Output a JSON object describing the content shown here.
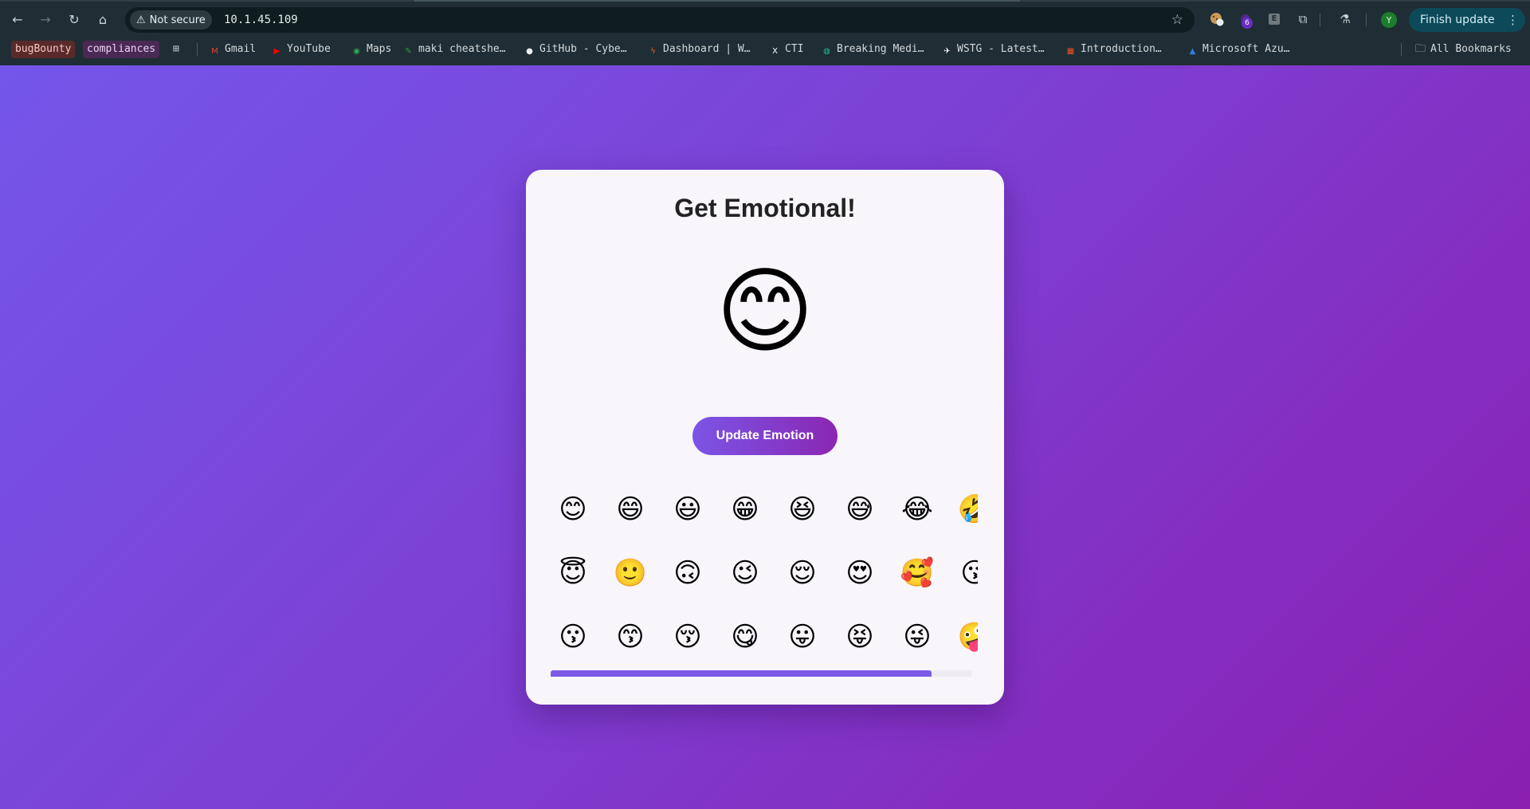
{
  "browser": {
    "security_label": "Not secure",
    "url": "10.1.45.109",
    "extension_badge": "6",
    "avatar_letter": "Y",
    "finish_update_label": "Finish update",
    "icons": {
      "back": "←",
      "forward": "→",
      "reload": "↻",
      "home": "⌂",
      "warning": "⚠",
      "star": "☆",
      "extensions": "⧉",
      "labs": "⚗",
      "menu": "⋮"
    }
  },
  "bookmarks": {
    "items": [
      {
        "label": "bugBounty",
        "name": "bookmark-bugbounty",
        "chip_bg": "#5a2a2a",
        "color": "#f3c9c2"
      },
      {
        "label": "compliances",
        "name": "bookmark-compliances",
        "chip_bg": "#4a2a55",
        "color": "#ecd2f4"
      },
      {
        "label": "⊞",
        "name": "bookmark-apps",
        "color": "#c8d2d4"
      },
      {
        "label": "Gmail",
        "name": "bookmark-gmail",
        "icon": "M",
        "icon_color": "#ea4335"
      },
      {
        "label": "YouTube",
        "name": "bookmark-youtube",
        "icon": "▶",
        "icon_color": "#ff0000"
      },
      {
        "label": "Maps",
        "name": "bookmark-maps",
        "icon": "◉",
        "icon_color": "#34a853"
      },
      {
        "label": "maki cheatshe…",
        "name": "bookmark-maki-cheatsheet",
        "icon": "✎",
        "icon_color": "#2ea043"
      },
      {
        "label": "GitHub - Cybe…",
        "name": "bookmark-github",
        "icon": "●",
        "icon_color": "#e6eeee"
      },
      {
        "label": "Dashboard | W…",
        "name": "bookmark-dashboard",
        "icon": "ϟ",
        "icon_color": "#f25a22"
      },
      {
        "label": "CTI",
        "name": "bookmark-cti",
        "icon": "X",
        "icon_color": "#ffffff"
      },
      {
        "label": "Breaking Medi…",
        "name": "bookmark-breaking-media",
        "icon": "◍",
        "icon_color": "#1fbf8f"
      },
      {
        "label": "WSTG - Latest…",
        "name": "bookmark-wstg",
        "icon": "✈",
        "icon_color": "#ffffff"
      },
      {
        "label": "Introduction…",
        "name": "bookmark-introduction",
        "icon": "▦",
        "icon_color": "#f25022"
      },
      {
        "label": "Microsoft Azu…",
        "name": "bookmark-microsoft-azure",
        "icon": "▲",
        "icon_color": "#2f7fe0"
      }
    ],
    "all_bookmarks_label": "All Bookmarks",
    "folder_icon": "🗀"
  },
  "app": {
    "title": "Get Emotional!",
    "current_emoji": "😊",
    "update_button_label": "Update Emotion",
    "emoji_rows": [
      [
        "😊",
        "😄",
        "😃",
        "😁",
        "😆",
        "😅",
        "😂",
        "🤣"
      ],
      [
        "😇",
        "🙂",
        "🙃",
        "😉",
        "😌",
        "😍",
        "🥰",
        "😘"
      ],
      [
        "😗",
        "😙",
        "😚",
        "😋",
        "😛",
        "😝",
        "😜",
        "🤪"
      ]
    ],
    "accent_color": "#7b5ae6"
  }
}
